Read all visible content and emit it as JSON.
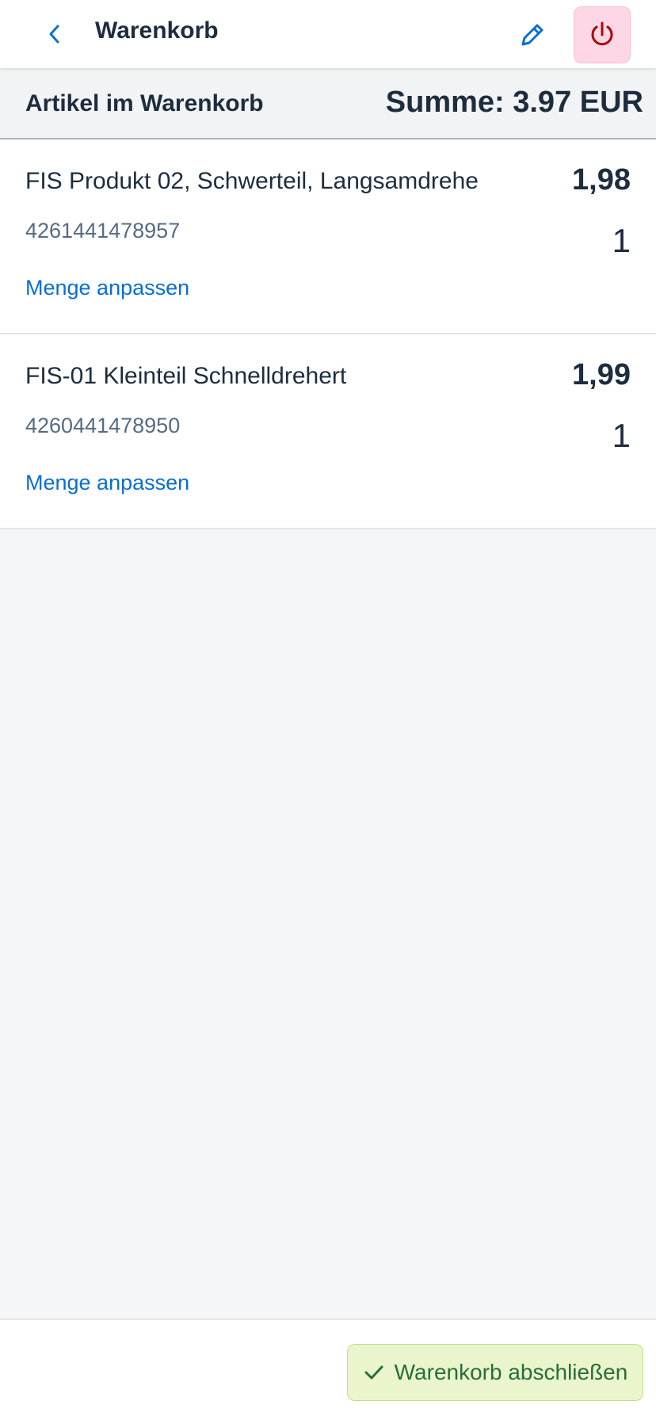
{
  "header": {
    "title": "Warenkorb",
    "back_icon": "chevron-left-icon",
    "edit_icon": "pencil-icon",
    "power_icon": "power-icon"
  },
  "summary": {
    "label": "Artikel im Warenkorb",
    "total": "Summe: 3.97 EUR"
  },
  "items": [
    {
      "name": "FIS Produkt 02, Schwerteil, Langsamdrehe",
      "ean": "4261441478957",
      "price": "1,98",
      "quantity": "1",
      "action_label": "Menge anpassen"
    },
    {
      "name": "FIS-01 Kleinteil Schnelldrehert",
      "ean": "4260441478950",
      "price": "1,99",
      "quantity": "1",
      "action_label": "Menge anpassen"
    }
  ],
  "footer": {
    "checkout_label": "Warenkorb abschließen",
    "checkout_icon": "checkmark-icon"
  },
  "colors": {
    "accent": "#0a6ed1",
    "text": "#1d2d3e",
    "muted": "#556b82",
    "power_bg": "#fdd7e6",
    "power_icon": "#aa0808",
    "success_bg": "#ebf5cb",
    "success_text": "#256f3a"
  }
}
